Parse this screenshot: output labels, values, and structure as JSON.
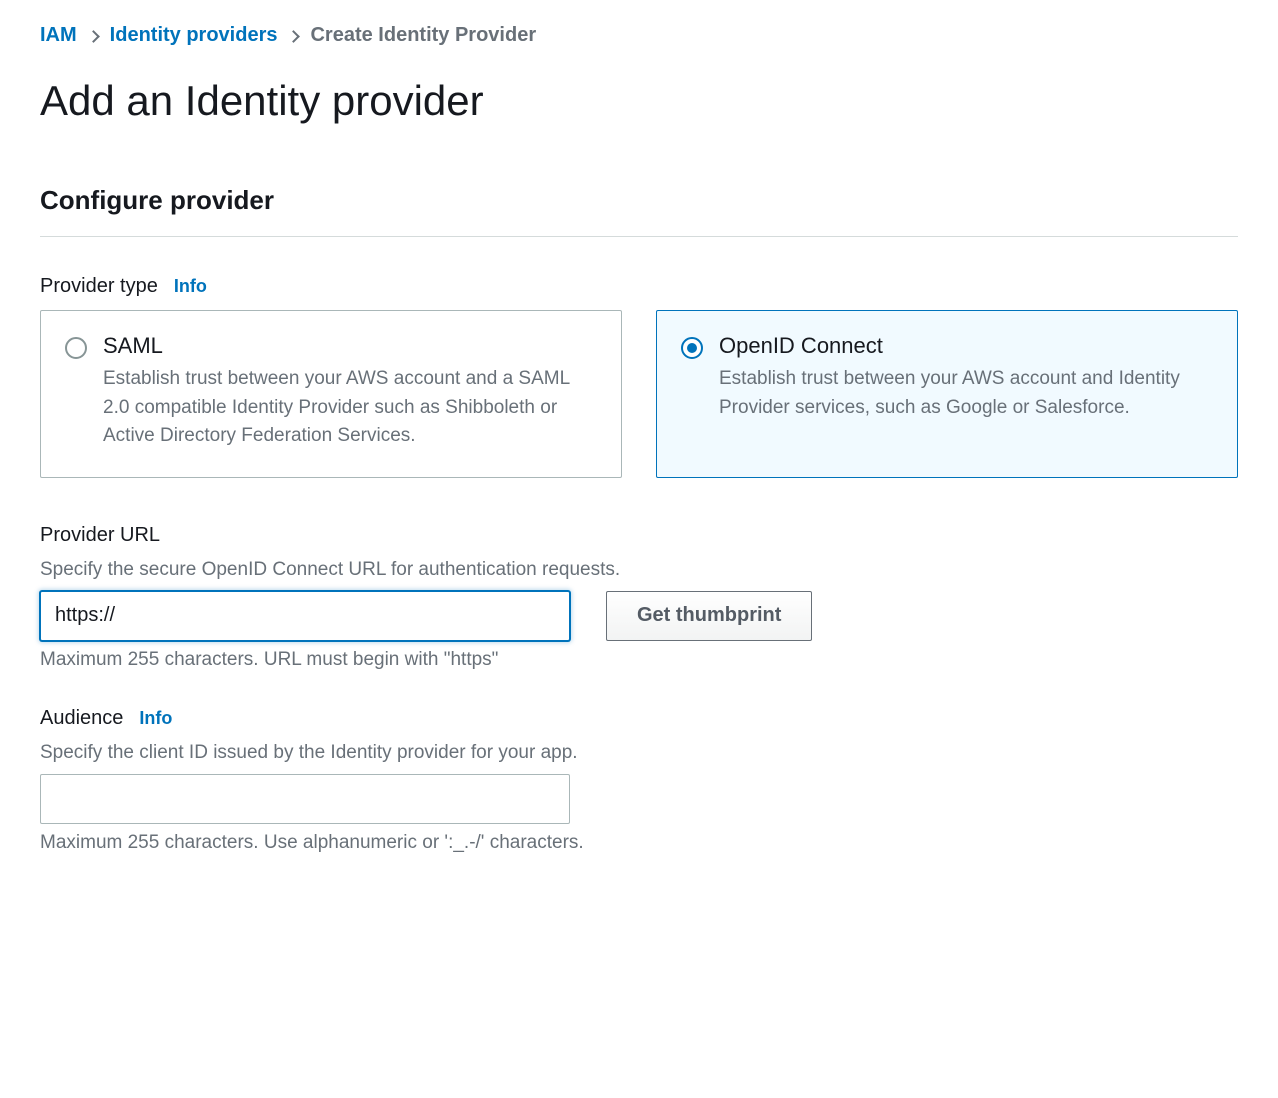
{
  "breadcrumb": {
    "items": [
      {
        "label": "IAM",
        "link": true
      },
      {
        "label": "Identity providers",
        "link": true
      },
      {
        "label": "Create Identity Provider",
        "link": false
      }
    ]
  },
  "page_title": "Add an Identity provider",
  "section_title": "Configure provider",
  "provider_type": {
    "label": "Provider type",
    "info_label": "Info",
    "options": [
      {
        "title": "SAML",
        "description": "Establish trust between your AWS account and a SAML 2.0 compatible Identity Provider such as Shibboleth or Active Directory Federation Services.",
        "selected": false
      },
      {
        "title": "OpenID Connect",
        "description": "Establish trust between your AWS account and Identity Provider services, such as Google or Salesforce.",
        "selected": true
      }
    ]
  },
  "provider_url": {
    "label": "Provider URL",
    "help": "Specify the secure OpenID Connect URL for authentication requests.",
    "value": "https://",
    "hint": "Maximum 255 characters. URL must begin with \"https\"",
    "button_label": "Get thumbprint"
  },
  "audience": {
    "label": "Audience",
    "info_label": "Info",
    "help": "Specify the client ID issued by the Identity provider for your app.",
    "value": "",
    "hint": "Maximum 255 characters. Use alphanumeric or ':_.-/' characters."
  }
}
